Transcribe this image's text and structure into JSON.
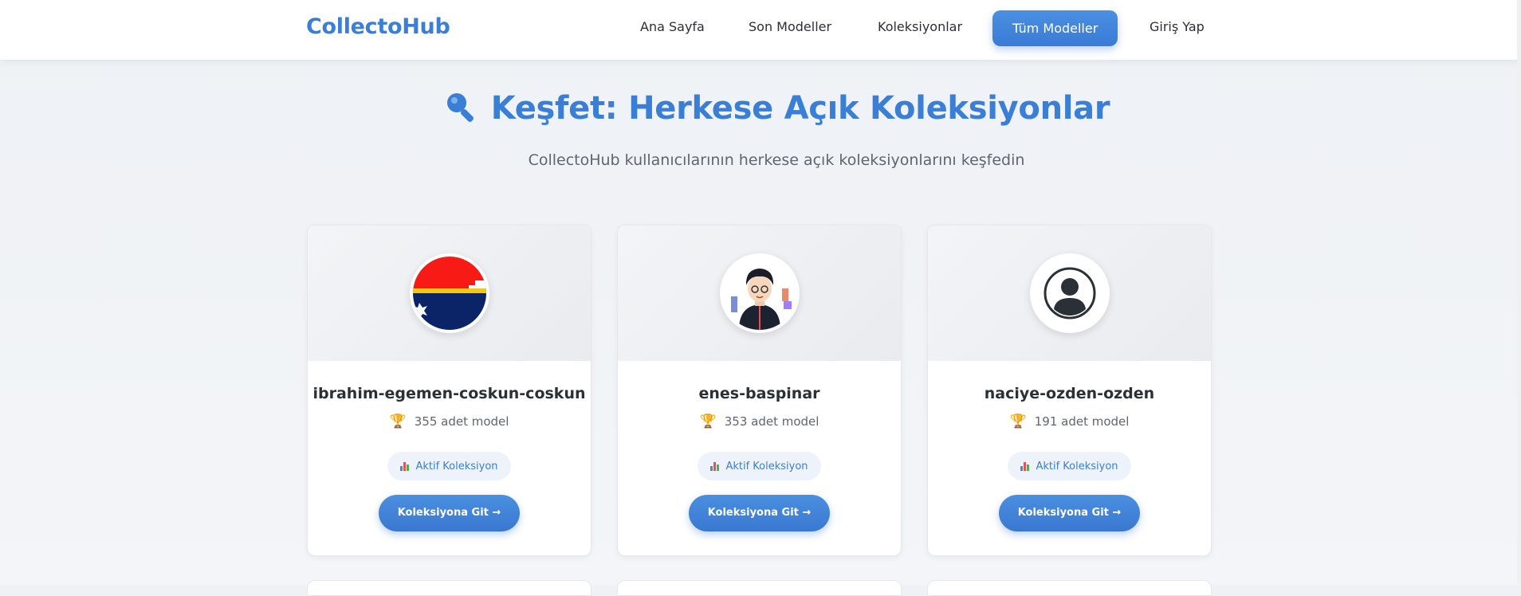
{
  "brand": "CollectoHub",
  "nav": [
    {
      "label": "Ana Sayfa",
      "active": false
    },
    {
      "label": "Son Modeller",
      "active": false
    },
    {
      "label": "Koleksiyonlar",
      "active": false
    },
    {
      "label": "Tüm Modeller",
      "active": true
    },
    {
      "label": "Giriş Yap",
      "active": false
    }
  ],
  "hero": {
    "icon": "magnifier-icon",
    "title": "Keşfet: Herkese Açık Koleksiyonlar",
    "subtitle": "CollectoHub kullanıcılarının herkese açık koleksiyonlarını keşfedin"
  },
  "cards": [
    {
      "avatar": "flag-avatar",
      "name": "ibrahim-egemen-coskun-coskun",
      "count": "355 adet model",
      "badge": "Aktif Koleksiyon",
      "button": "Koleksiyona Git →"
    },
    {
      "avatar": "illustrated-person-avatar",
      "name": "enes-baspinar",
      "count": "353 adet model",
      "badge": "Aktif Koleksiyon",
      "button": "Koleksiyona Git →"
    },
    {
      "avatar": "default-user-avatar",
      "name": "naciye-ozden-ozden",
      "count": "191 adet model",
      "badge": "Aktif Koleksiyon",
      "button": "Koleksiyona Git →"
    }
  ],
  "colors": {
    "accent": "#3a7fd5",
    "text": "#2b2f36",
    "muted": "#5f6670"
  }
}
